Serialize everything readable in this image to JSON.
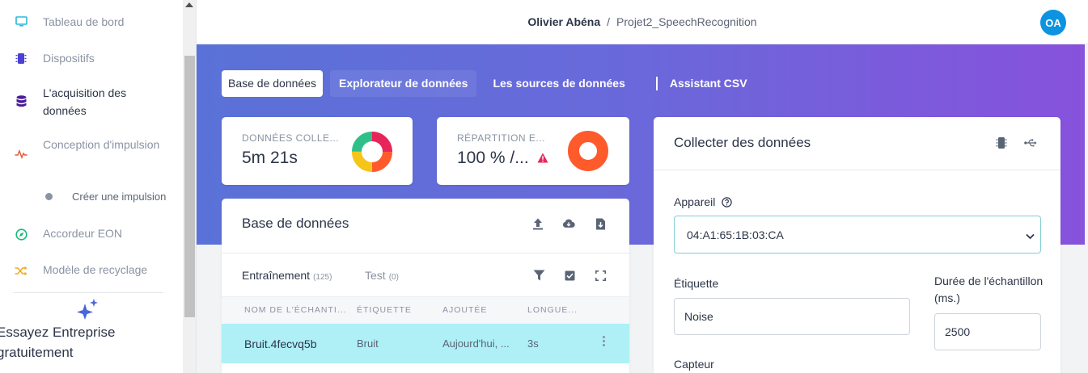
{
  "sidebar": {
    "items": [
      {
        "label": "Tableau de bord",
        "icon": "monitor-icon"
      },
      {
        "label": "Dispositifs",
        "icon": "chip-icon"
      },
      {
        "label": "L'acquisition des données",
        "icon": "database-icon"
      },
      {
        "label": "Conception d'impulsion",
        "icon": "pulse-icon"
      },
      {
        "label": "Accordeur EON",
        "icon": "compass-icon"
      },
      {
        "label": "Modèle de recyclage",
        "icon": "shuffle-icon"
      }
    ],
    "subitem": "Créer une impulsion",
    "promo": "Essayez Entreprise gratuitement"
  },
  "header": {
    "owner": "Olivier Abéna",
    "separator": "/",
    "project": "Projet2_SpeechRecognition",
    "avatar": "OA"
  },
  "tabs": [
    "Base de données",
    "Explorateur de données",
    "Les sources de données",
    "Assistant CSV"
  ],
  "stats": {
    "collected": {
      "label": "DONNÉES COLLE...",
      "value": "5m 21s"
    },
    "split": {
      "label": "RÉPARTITION E...",
      "value": "100 % /..."
    }
  },
  "dataset": {
    "title": "Base de données",
    "train_tab": "Entraînement",
    "train_count": "(125)",
    "test_tab": "Test",
    "test_count": "(0)",
    "columns": [
      "NOM DE L'ÉCHANTI...",
      "ÉTIQUETTE",
      "AJOUTÉE",
      "LONGUE..."
    ],
    "rows": [
      {
        "name": "Bruit.4fecvq5b",
        "label": "Bruit",
        "added": "Aujourd'hui, ...",
        "length": "3s"
      }
    ]
  },
  "collect": {
    "title": "Collecter des données",
    "device_label": "Appareil",
    "device_value": "04:A1:65:1B:03:CA",
    "label_label": "Étiquette",
    "label_value": "Noise",
    "duration_label": "Durée de l'échantillon (ms.)",
    "duration_value": "2500",
    "sensor_label": "Capteur"
  },
  "colors": {
    "accent": "#0e93e0",
    "gradient_start": "#5a72d8",
    "gradient_end": "#8752dc",
    "row_highlight": "#aef0f6",
    "warning": "#e8255a",
    "split_donut": "#ff5a2c"
  }
}
